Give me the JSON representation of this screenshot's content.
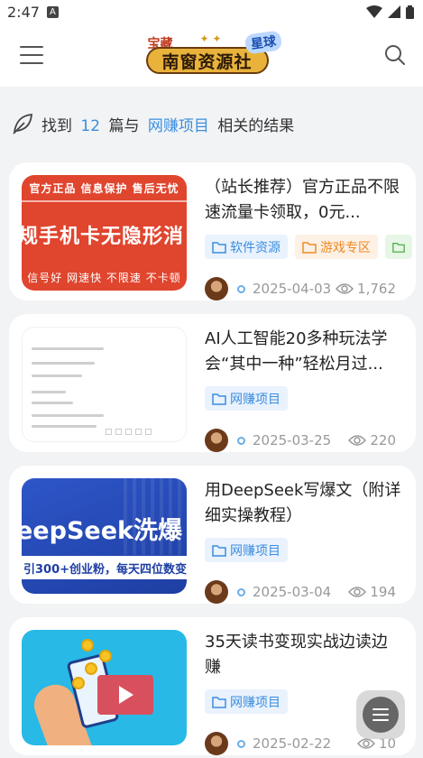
{
  "status_bar": {
    "time": "2:47",
    "notif_letter": "A"
  },
  "header": {
    "logo": {
      "top_text": "宝藏",
      "main_text": "南窗资源社",
      "badge_text": "星球"
    }
  },
  "search_summary": {
    "prefix": "找到",
    "count": "12",
    "middle": "篇与",
    "keyword": "网赚项目",
    "suffix": "相关的结果"
  },
  "posts": [
    {
      "title": "（站长推荐）官方正品不限速流量卡领取，0元...",
      "thumb_lines": [
        "官方正品 信息保护 售后无忧",
        "规手机卡无隐形消",
        "信号好 网速快 不限速 不卡顿"
      ],
      "tags": [
        {
          "label": "软件资源",
          "color": "blue"
        },
        {
          "label": "游戏专区",
          "color": "orange"
        },
        {
          "label": "",
          "color": "green"
        }
      ],
      "date": "2025-04-03",
      "views": "1,762"
    },
    {
      "title": "AI人工智能20多种玩法学会“其中一种”轻松月过...",
      "thumb_lines": [],
      "tags": [
        {
          "label": "网赚项目",
          "color": "blue"
        }
      ],
      "date": "2025-03-25",
      "views": "220"
    },
    {
      "title": "用DeepSeek写爆文（附详细实操教程）",
      "thumb_lines": [
        "eepSeek洗爆",
        "引300+创业粉，每天四位数变"
      ],
      "tags": [
        {
          "label": "网赚项目",
          "color": "blue"
        }
      ],
      "date": "2025-03-04",
      "views": "194"
    },
    {
      "title": "35天读书变现实战边读边赚",
      "thumb_lines": [],
      "tags": [
        {
          "label": "网赚项目",
          "color": "blue"
        }
      ],
      "date": "2025-02-22",
      "views": "10"
    }
  ],
  "icons": {
    "menu": "menu-icon",
    "search": "search-icon",
    "leaf": "leaf-icon",
    "folder": "folder-icon",
    "eye": "eye-icon",
    "fab": "list-icon"
  },
  "colors": {
    "accent": "#3b8de0",
    "orange_tag": "#f08a24",
    "green_tag": "#4cae48"
  }
}
